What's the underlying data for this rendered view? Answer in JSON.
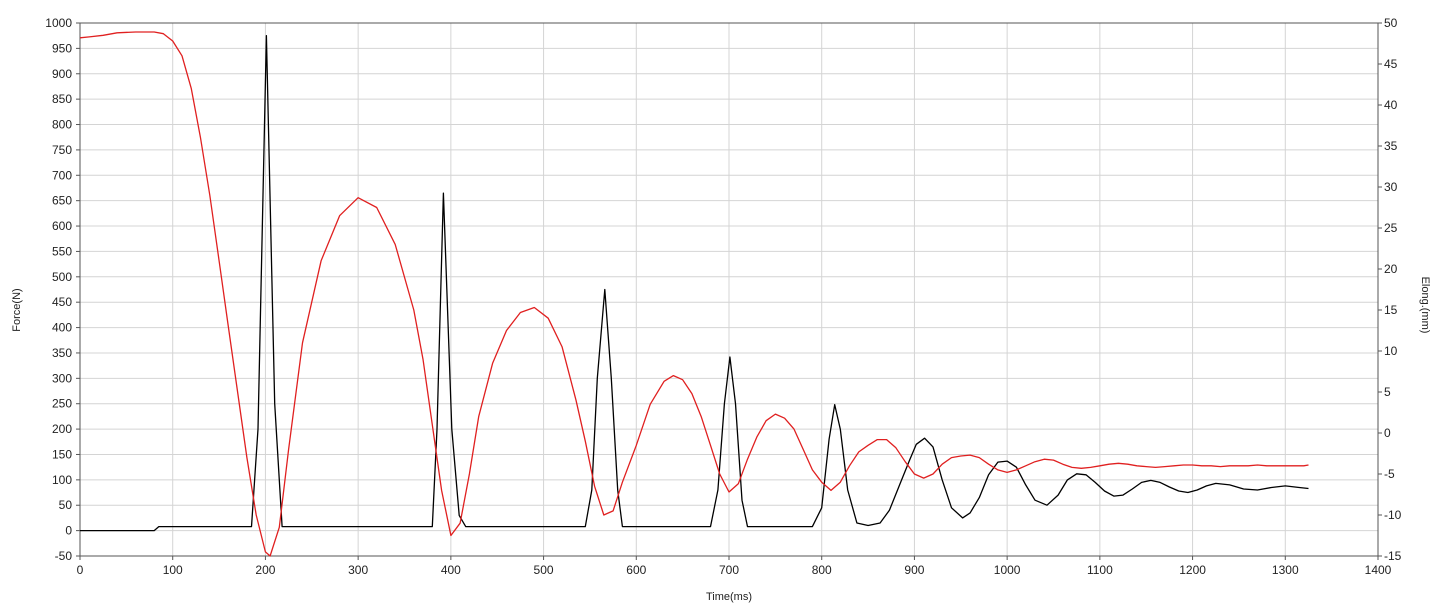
{
  "chart_data": {
    "type": "line",
    "xlabel": "Time(ms)",
    "ylabel": "Force(N)",
    "y2label": "Elong.(mm)",
    "xlim": [
      0,
      1400
    ],
    "ylim": [
      -50,
      1000
    ],
    "y2lim": [
      -15,
      50
    ],
    "grid": true,
    "x_ticks": [
      "0",
      "100",
      "200",
      "300",
      "400",
      "500",
      "600",
      "700",
      "800",
      "900",
      "1000",
      "1100",
      "1200",
      "1300",
      "1400"
    ],
    "y_ticks": [
      "-50",
      "0",
      "50",
      "100",
      "150",
      "200",
      "250",
      "300",
      "350",
      "400",
      "450",
      "500",
      "550",
      "600",
      "650",
      "700",
      "750",
      "800",
      "850",
      "900",
      "950",
      "1000"
    ],
    "y2_ticks": [
      "-15",
      "-10",
      "-5",
      "0",
      "5",
      "10",
      "15",
      "20",
      "25",
      "30",
      "35",
      "40",
      "45",
      "50"
    ],
    "series": [
      {
        "axis": "left",
        "color": "#000000",
        "x": [
          0,
          80,
          85,
          185,
          192,
          201,
          210,
          218,
          223,
          380,
          385,
          392,
          401,
          409,
          416,
          422,
          545,
          552,
          558,
          566,
          573,
          580,
          585,
          680,
          688,
          695,
          701,
          707,
          714,
          720,
          790,
          800,
          808,
          814,
          820,
          828,
          838,
          850,
          863,
          873,
          884,
          895,
          902,
          911,
          920,
          930,
          940,
          952,
          960,
          970,
          980,
          990,
          1000,
          1010,
          1020,
          1030,
          1043,
          1055,
          1065,
          1075,
          1085,
          1095,
          1105,
          1115,
          1125,
          1135,
          1145,
          1155,
          1165,
          1175,
          1185,
          1195,
          1205,
          1215,
          1225,
          1240,
          1255,
          1270,
          1285,
          1300,
          1315,
          1325
        ],
        "y": [
          0,
          0,
          8,
          8,
          200,
          975,
          250,
          8,
          8,
          8,
          200,
          665,
          200,
          30,
          8,
          8,
          8,
          80,
          300,
          475,
          300,
          80,
          8,
          8,
          80,
          250,
          342,
          250,
          60,
          8,
          8,
          45,
          180,
          248,
          200,
          80,
          15,
          10,
          15,
          40,
          90,
          140,
          170,
          182,
          165,
          100,
          45,
          25,
          35,
          65,
          110,
          135,
          137,
          125,
          90,
          60,
          50,
          70,
          100,
          112,
          110,
          95,
          78,
          68,
          70,
          82,
          95,
          99,
          95,
          86,
          78,
          75,
          80,
          88,
          93,
          90,
          82,
          80,
          85,
          88,
          85,
          83
        ]
      },
      {
        "axis": "right",
        "color": "#e02020",
        "x": [
          0,
          10,
          25,
          40,
          60,
          80,
          90,
          100,
          110,
          120,
          130,
          140,
          150,
          160,
          170,
          180,
          190,
          200,
          205,
          215,
          225,
          240,
          260,
          280,
          300,
          320,
          340,
          360,
          370,
          380,
          390,
          400,
          410,
          420,
          430,
          445,
          460,
          475,
          490,
          505,
          520,
          535,
          545,
          555,
          565,
          575,
          585,
          600,
          615,
          630,
          640,
          650,
          660,
          670,
          680,
          690,
          700,
          710,
          720,
          730,
          740,
          750,
          760,
          770,
          780,
          790,
          800,
          810,
          820,
          830,
          840,
          850,
          860,
          870,
          880,
          890,
          900,
          910,
          920,
          930,
          940,
          950,
          960,
          970,
          980,
          990,
          1000,
          1010,
          1020,
          1030,
          1040,
          1050,
          1060,
          1070,
          1080,
          1090,
          1100,
          1110,
          1120,
          1130,
          1140,
          1150,
          1160,
          1170,
          1180,
          1190,
          1200,
          1210,
          1220,
          1230,
          1240,
          1250,
          1260,
          1270,
          1280,
          1290,
          1300,
          1310,
          1320,
          1325
        ],
        "y": [
          48.2,
          48.3,
          48.5,
          48.8,
          48.9,
          48.9,
          48.7,
          47.8,
          46.0,
          42.0,
          36.0,
          29.0,
          21.0,
          13.0,
          5.0,
          -3.0,
          -10.0,
          -14.5,
          -15.0,
          -11.5,
          -2.0,
          11.0,
          21.0,
          26.5,
          28.7,
          27.5,
          23.0,
          15.0,
          9.0,
          1.0,
          -7.0,
          -12.5,
          -11.0,
          -5.0,
          2.0,
          8.5,
          12.5,
          14.7,
          15.3,
          14.0,
          10.5,
          4.0,
          -1.0,
          -6.5,
          -10.0,
          -9.5,
          -6.0,
          -1.5,
          3.5,
          6.3,
          7.0,
          6.5,
          4.8,
          2.0,
          -1.5,
          -5.0,
          -7.2,
          -6.2,
          -3.2,
          -0.5,
          1.5,
          2.3,
          1.8,
          0.5,
          -2.0,
          -4.5,
          -6.0,
          -7.0,
          -6.0,
          -4.0,
          -2.3,
          -1.5,
          -0.8,
          -0.8,
          -1.8,
          -3.5,
          -5.0,
          -5.5,
          -5.0,
          -3.8,
          -3.0,
          -2.8,
          -2.7,
          -3.0,
          -3.8,
          -4.5,
          -4.8,
          -4.5,
          -4.0,
          -3.5,
          -3.2,
          -3.3,
          -3.8,
          -4.2,
          -4.3,
          -4.2,
          -4.0,
          -3.8,
          -3.7,
          -3.8,
          -4.0,
          -4.1,
          -4.2,
          -4.1,
          -4.0,
          -3.9,
          -3.9,
          -4.0,
          -4.0,
          -4.1,
          -4.0,
          -4.0,
          -4.0,
          -3.9,
          -4.0,
          -4.0,
          -4.0,
          -4.0,
          -4.0,
          -3.9
        ]
      }
    ]
  }
}
